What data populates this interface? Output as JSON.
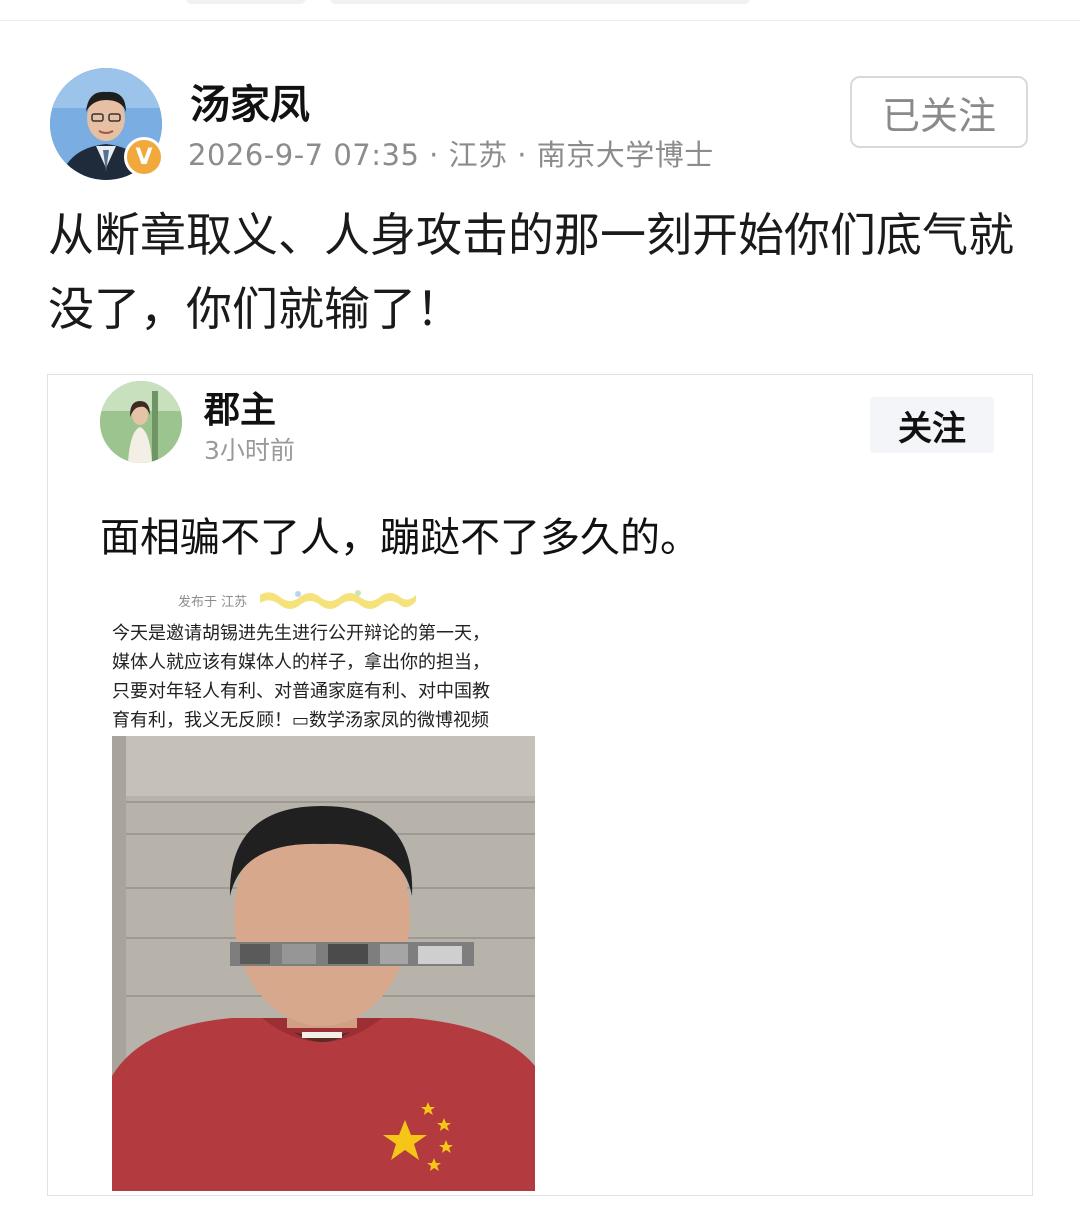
{
  "post": {
    "author": "汤家凤",
    "meta": "2026-9-7 07:35 · 江苏 · 南京大学博士",
    "verified_badge": "V",
    "follow_label": "已关注",
    "text": "从断章取义、人身攻击的那一刻开始你们底气就没了，你们就输了！"
  },
  "embed": {
    "author": "郡主",
    "time": "3小时前",
    "follow_label": "关注",
    "text": "面相骗不了人，蹦跶不了多久的。",
    "screenshot": {
      "published": "发布于 江苏",
      "lines": [
        "今天是邀请胡锡进先生进行公开辩论的第一天，",
        "媒体人就应该有媒体人的样子，拿出你的担当，",
        "只要对年轻人有利、对普通家庭有利、对中国教",
        "育有利，我义无反顾！▭数学汤家凤的微博视频"
      ]
    }
  },
  "colors": {
    "badge": "#f2a93b",
    "follow_border": "#d9d9d9",
    "shirt": "#b33a3e",
    "star": "#f5c518"
  }
}
